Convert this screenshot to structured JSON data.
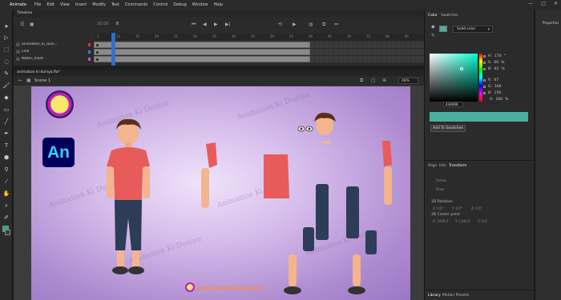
{
  "app_title": "Animate",
  "menu": [
    "File",
    "Edit",
    "View",
    "Insert",
    "Modify",
    "Text",
    "Commands",
    "Control",
    "Debug",
    "Window",
    "Help"
  ],
  "window_controls": [
    "—",
    "□",
    "✕"
  ],
  "timeline": {
    "tab": "Timeline",
    "frame_display": "20.00",
    "frame_fps": "8",
    "ruler": [
      "5",
      "10",
      "15",
      "20",
      "25",
      "30",
      "35",
      "40",
      "45",
      "50",
      "55",
      "60",
      "65",
      "70",
      "75",
      "80",
      "85"
    ],
    "layers": [
      {
        "name": "animation_ki_duni...",
        "color": "#e0302e"
      },
      {
        "name": "Line",
        "color": "#3a7ff0"
      },
      {
        "name": "Water_mark",
        "color": "#e040c8"
      }
    ]
  },
  "document_tab": "animation ki duniya.fla*",
  "scene_label": "Scene 1",
  "zoom": "48%",
  "stage": {
    "watermark": "Animation Ki Duniya",
    "logo_text": "An",
    "footer_url": "www.animationkiduniya.com"
  },
  "color_panel": {
    "tabs": [
      "Color",
      "Swatches"
    ],
    "fill_mode": "Solid color",
    "hsb": [
      {
        "label": "H:",
        "value": "170",
        "unit": "°"
      },
      {
        "label": "S:",
        "value": "60",
        "unit": "%"
      },
      {
        "label": "B:",
        "value": "65",
        "unit": "%"
      }
    ],
    "rgb": [
      {
        "label": "R:",
        "value": "67"
      },
      {
        "label": "G:",
        "value": "166"
      },
      {
        "label": "B:",
        "value": "150"
      }
    ],
    "alpha": {
      "label": "A:",
      "value": "100",
      "unit": "%"
    },
    "hex": "43A696",
    "add_button": "Add To Swatches",
    "preview_color": "#48b09c"
  },
  "transform_panel": {
    "tabs": [
      "Align",
      "Info",
      "Transform"
    ],
    "rows": [
      "Rotate",
      "Skew"
    ],
    "rotation_head": "3D Rotation",
    "rotation_values": [
      "X: 0.0°",
      "Y: 0.0°",
      "Z: 0.0°"
    ],
    "center_head": "3D Center point",
    "center_values": [
      "X: 2449.5",
      "Y: 1344.0",
      "Z: 0.0"
    ]
  },
  "library_tabs": [
    "Library",
    "Motion Presets"
  ],
  "properties_label": "Properties"
}
